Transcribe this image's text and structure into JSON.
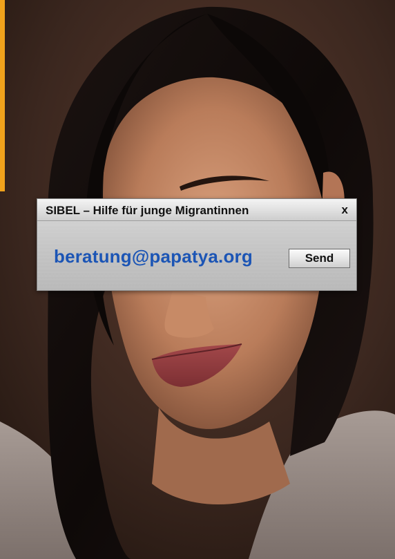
{
  "dialog": {
    "title": "SIBEL – Hilfe für junge Migrantinnen",
    "close_label": "x",
    "email": "beratung@papatya.org",
    "send_label": "Send"
  },
  "colors": {
    "accent_strip": "#f0a21c",
    "email_text": "#1c55b5"
  }
}
